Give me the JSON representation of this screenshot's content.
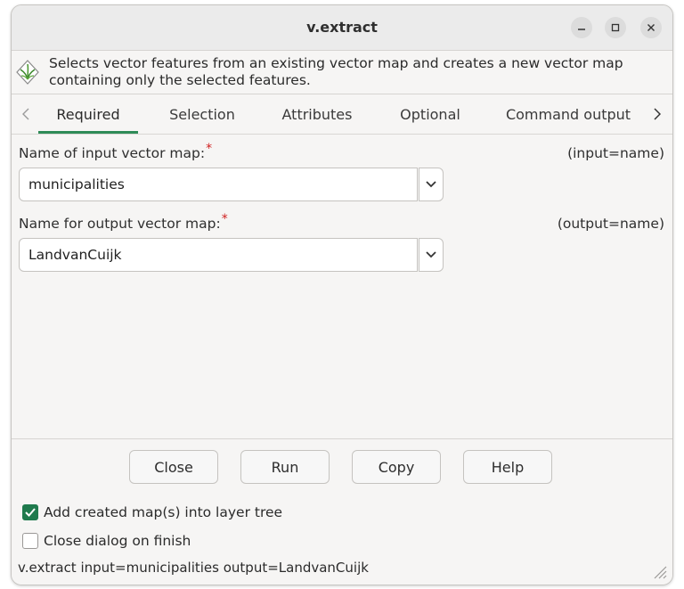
{
  "window": {
    "title": "v.extract"
  },
  "description": {
    "text_line1": "Selects vector features from an existing vector map and creates a new vector map",
    "text_line2": "containing only the selected features.",
    "icon": "grass-gis-icon"
  },
  "tabs": [
    {
      "label": "Required",
      "active": true
    },
    {
      "label": "Selection",
      "active": false
    },
    {
      "label": "Attributes",
      "active": false
    },
    {
      "label": "Optional",
      "active": false
    },
    {
      "label": "Command output",
      "active": false
    }
  ],
  "fields": {
    "input": {
      "label": "Name of input vector map:",
      "required_mark": "*",
      "key": "(input=name)",
      "value": "municipalities"
    },
    "output": {
      "label": "Name for output vector map:",
      "required_mark": "*",
      "key": "(output=name)",
      "value": "LandvanCuijk"
    }
  },
  "buttons": {
    "close": "Close",
    "run": "Run",
    "copy": "Copy",
    "help": "Help"
  },
  "options": {
    "add_to_layer_tree": {
      "label": "Add created map(s) into layer tree",
      "checked": true
    },
    "close_on_finish": {
      "label": "Close dialog on finish",
      "checked": false
    }
  },
  "command_line": "v.extract input=municipalities output=LandvanCuijk",
  "colors": {
    "accent": "#2e8b57",
    "check_fill": "#1f7a4d",
    "required": "#d02020"
  }
}
